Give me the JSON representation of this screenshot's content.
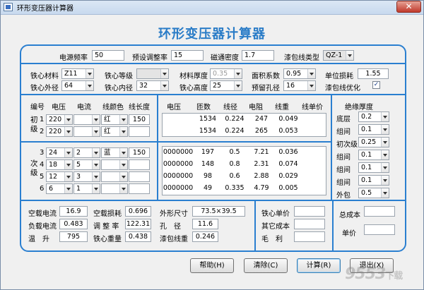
{
  "window": {
    "title": "环形变压器计算器",
    "close_label": "✕"
  },
  "main_title": "环形变压器计算器",
  "row1": {
    "freq_label": "电源频率",
    "freq_value": "50",
    "adjust_label": "预设调整率",
    "adjust_value": "15",
    "flux_label": "磁通密度",
    "flux_value": "1.7",
    "wire_type_label": "漆包线类型",
    "wire_type_value": "QZ-1"
  },
  "core": {
    "material_label": "铁心材料",
    "material_value": "Z11",
    "grade_label": "铁心等级",
    "grade_value": "",
    "thickness_label": "材料厚度",
    "thickness_value": "0.35",
    "area_label": "面积系数",
    "area_value": "0.95",
    "unit_loss_label": "单位损耗",
    "unit_loss_value": "1.55",
    "outer_label": "铁心外径",
    "outer_value": "64",
    "inner_label": "铁心内径",
    "inner_value": "32",
    "height_label": "铁心高度",
    "height_value": "25",
    "hole_label": "预留孔径",
    "hole_value": "16",
    "opt_label": "漆包线优化",
    "opt_checked": "✓"
  },
  "winding_headers": [
    "编号",
    "电压",
    "电流",
    "线颜色",
    "线长度"
  ],
  "calc_headers": [
    "电压",
    "匝数",
    "线径",
    "电阻",
    "线重",
    "线单价"
  ],
  "primary_label": "初级",
  "secondary_label": "次级",
  "primary_rows": [
    {
      "no": "1",
      "voltage": "220",
      "current": "",
      "color": "红",
      "length": "150",
      "c_voltage": "",
      "turns": "1534",
      "diameter": "0.224",
      "resistance": "247",
      "weight": "0.049",
      "price": ""
    },
    {
      "no": "2",
      "voltage": "220",
      "current": "",
      "color": "红",
      "length": "",
      "c_voltage": "",
      "turns": "1534",
      "diameter": "0.224",
      "resistance": "265",
      "weight": "0.053",
      "price": ""
    }
  ],
  "secondary_rows": [
    {
      "no": "3",
      "voltage": "24",
      "current": "2",
      "color": "蓝",
      "length": "150",
      "c_voltage": "0000000",
      "turns": "197",
      "diameter": "0.5",
      "resistance": "7.21",
      "weight": "0.036",
      "price": ""
    },
    {
      "no": "4",
      "voltage": "18",
      "current": "5",
      "color": "",
      "length": "",
      "c_voltage": "0000000",
      "turns": "148",
      "diameter": "0.8",
      "resistance": "2.31",
      "weight": "0.074",
      "price": ""
    },
    {
      "no": "5",
      "voltage": "12",
      "current": "3",
      "color": "",
      "length": "",
      "c_voltage": "0000000",
      "turns": "98",
      "diameter": "0.6",
      "resistance": "2.88",
      "weight": "0.029",
      "price": ""
    },
    {
      "no": "6",
      "voltage": "6",
      "current": "1",
      "color": "",
      "length": "",
      "c_voltage": "0000000",
      "turns": "49",
      "diameter": "0.335",
      "resistance": "4.79",
      "weight": "0.005",
      "price": ""
    }
  ],
  "insulation": {
    "title": "绝缘厚度",
    "rows": [
      {
        "label": "底层",
        "value": "0.2"
      },
      {
        "label": "组间",
        "value": "0.1"
      },
      {
        "label": "初次级",
        "value": "0.25"
      },
      {
        "label": "组间",
        "value": "0.1"
      },
      {
        "label": "组间",
        "value": "0.1"
      },
      {
        "label": "组间",
        "value": "0.1"
      },
      {
        "label": "外包",
        "value": "0.5"
      }
    ]
  },
  "results": {
    "noload_current_label": "空载电流",
    "noload_current_value": "16.9",
    "load_current_label": "负载电流",
    "load_current_value": "0.483",
    "temp_rise_label": "温　升",
    "temp_rise_value": "795",
    "noload_loss_label": "空载损耗",
    "noload_loss_value": "0.696",
    "regulation_label": "调 整 率",
    "regulation_value": "122.31",
    "core_weight_label": "铁心重量",
    "core_weight_value": "0.438",
    "dimension_label": "外形尺寸",
    "dimension_value": "73.5×39.5",
    "hole_label": "孔　径",
    "hole_value": "11.6",
    "wire_weight_label": "漆包线重",
    "wire_weight_value": "0.246"
  },
  "cost": {
    "core_price_label": "铁心单价",
    "core_price_value": "",
    "other_label": "其它成本",
    "other_value": "",
    "profit_label": "毛　利",
    "profit_value": "",
    "total_label": "总成本",
    "total_value": "",
    "unit_label": "单价",
    "unit_value": ""
  },
  "buttons": {
    "help": "帮助(H)",
    "clear": "清除(C)",
    "calc": "计算(R)",
    "exit": "退出(X)"
  },
  "watermark": {
    "main": "9553",
    "suffix": "下载"
  }
}
